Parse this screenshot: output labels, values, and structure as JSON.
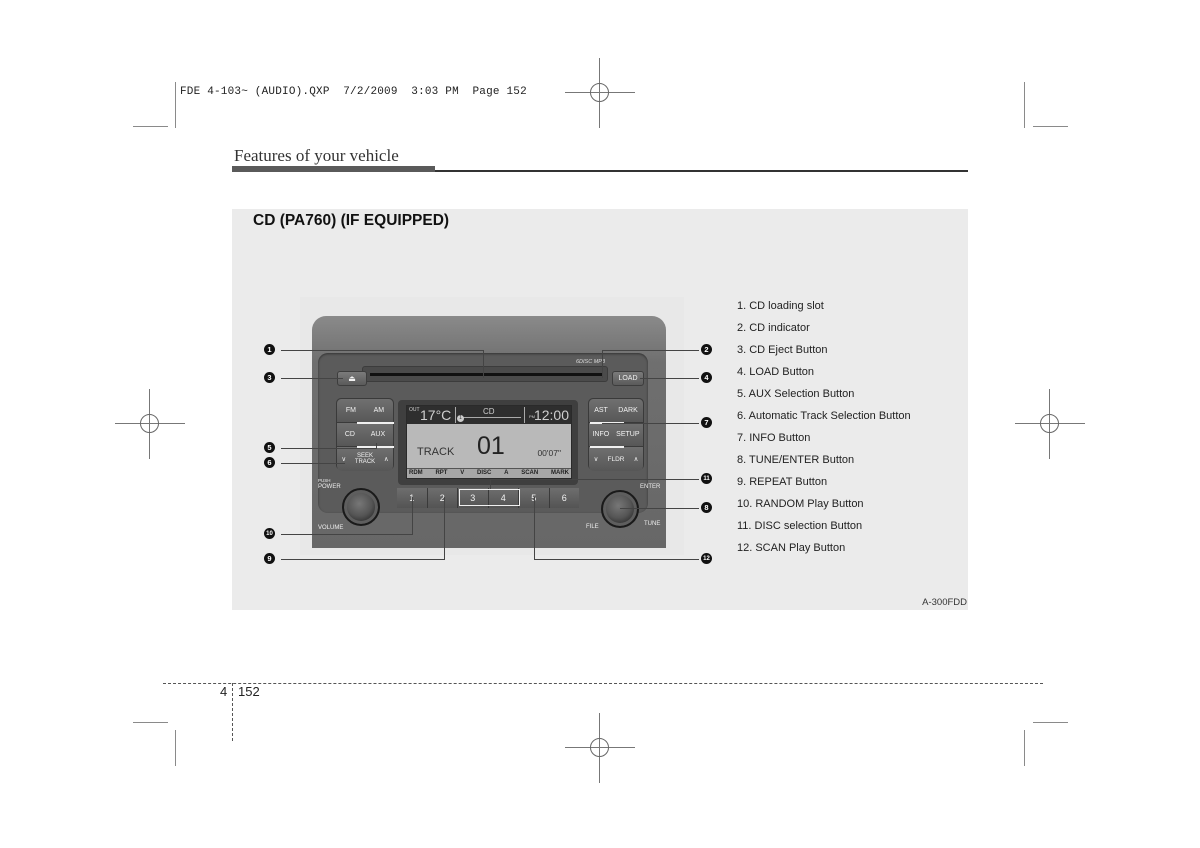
{
  "print_slug": {
    "file": "FDE 4-103~ (AUDIO).QXP",
    "date": "7/2/2009",
    "time": "3:03 PM",
    "page_label": "Page 152"
  },
  "header": {
    "section_title": "Features of your vehicle"
  },
  "figure": {
    "title": "CD (PA760) (IF EQUIPPED)",
    "code": "A-300FDD",
    "radio": {
      "eject_symbol": "⏏",
      "load_label": "LOAD",
      "logo_text": "6DISC MP3",
      "left_buttons": [
        [
          "FM",
          "AM"
        ],
        [
          "CD",
          "AUX"
        ]
      ],
      "seek_label_top": "SEEK",
      "seek_label_bottom": "TRACK",
      "right_buttons": [
        [
          "AST",
          "DARK"
        ],
        [
          "INFO",
          "SETUP"
        ]
      ],
      "folder_label": "FLDR",
      "down_arrow": "∨",
      "up_arrow": "∧",
      "display": {
        "out_label": "OUT",
        "temperature": "17°C",
        "source": "CD",
        "disc_indicator": "1",
        "pm_label": "PM",
        "clock": "12:00",
        "track_label": "TRACK",
        "track_number": "01",
        "elapsed": "00'07\"",
        "soft_keys": [
          "RDM",
          "RPT",
          "V",
          "DISC",
          "A",
          "SCAN",
          "MARK"
        ]
      },
      "presets": [
        "1",
        "2",
        "3",
        "4",
        "5",
        "6"
      ],
      "left_knob": {
        "top_label_small": "PUSH",
        "top_label": "POWER",
        "bottom_label": "VOLUME"
      },
      "right_knob": {
        "top_label": "ENTER",
        "left_label": "FILE",
        "right_label": "TUNE"
      }
    },
    "callouts": [
      "1",
      "2",
      "3",
      "4",
      "5",
      "6",
      "7",
      "8",
      "9",
      "10",
      "11",
      "12"
    ],
    "legend": [
      "1. CD loading slot",
      "2. CD indicator",
      "3. CD Eject Button",
      "4. LOAD Button",
      "5. AUX Selection Button",
      "6. Automatic Track Selection Button",
      "7. INFO Button",
      "8. TUNE/ENTER Button",
      "9. REPEAT Button",
      "10. RANDOM Play Button",
      "11. DISC selection Button",
      "12. SCAN Play Button"
    ]
  },
  "footer": {
    "chapter": "4",
    "page": "152"
  }
}
